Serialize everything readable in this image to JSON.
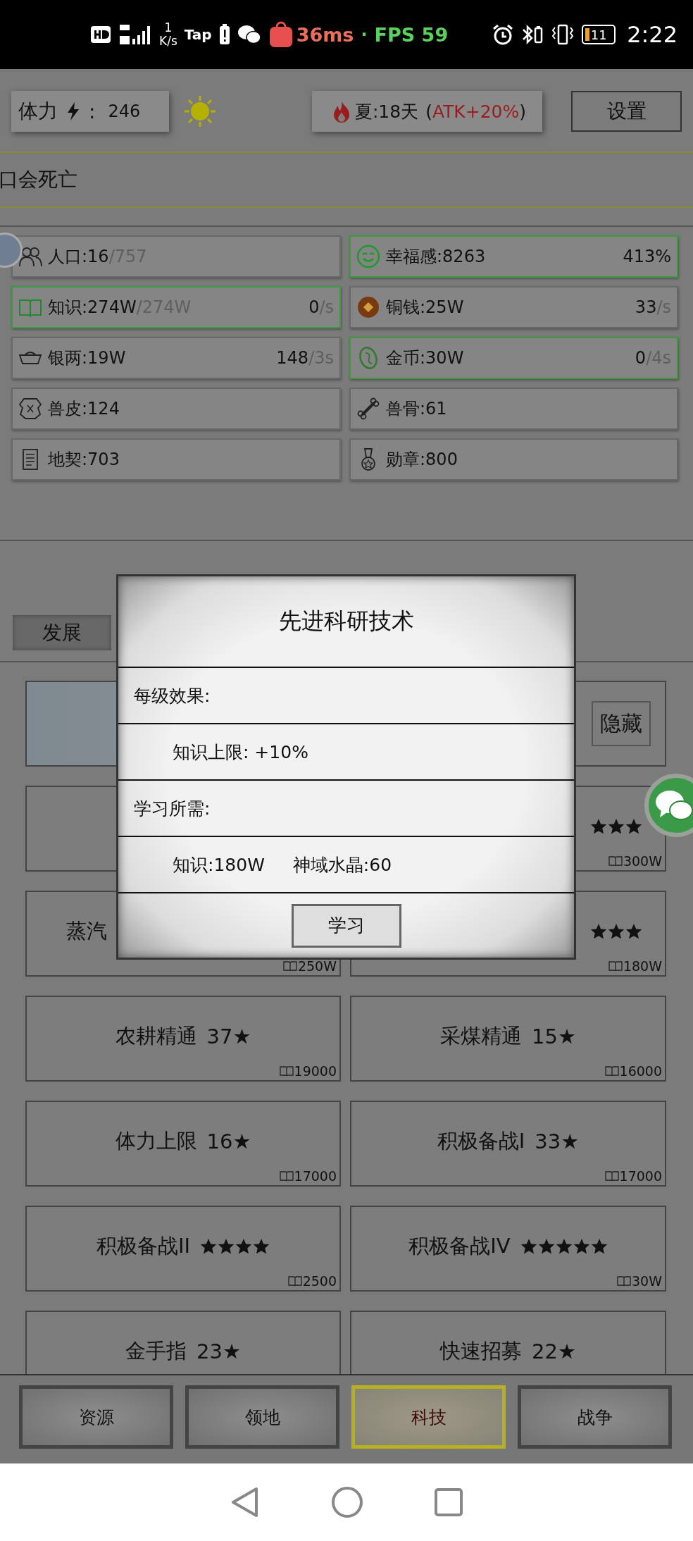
{
  "status_bar": {
    "speed_value": "1",
    "speed_unit": "K/s",
    "app_label": "Tap",
    "latency": "36ms",
    "dot": "·",
    "fps": "FPS 59",
    "battery": "11",
    "time": "2:22"
  },
  "top_bar": {
    "stamina_label": "体力",
    "stamina_colon": ":",
    "stamina_value": "246",
    "season": "夏:18天",
    "paren_open": "(",
    "season_bonus": "ATK+20%",
    "paren_close": ")",
    "settings": "设置"
  },
  "ticker": "口会死亡",
  "resources": [
    {
      "text": "人口:16",
      "limit": "/757",
      "highlighted": false
    },
    {
      "text": "幸福感:8263",
      "rate": "413%",
      "highlighted": true
    },
    {
      "text": "知识:274W",
      "limit": "/274W",
      "rate": "0",
      "period": "/s",
      "highlighted": true
    },
    {
      "text": "铜钱:25W",
      "rate": "33",
      "period": "/s",
      "highlighted": false
    },
    {
      "text": "银两:19W",
      "rate": "148",
      "period": "/3s",
      "highlighted": false
    },
    {
      "text": "金币:30W",
      "rate": "0",
      "period": "/4s",
      "highlighted": true
    },
    {
      "text": "兽皮:124",
      "highlighted": false
    },
    {
      "text": "兽骨:61",
      "highlighted": false
    },
    {
      "text": "地契:703",
      "highlighted": false
    },
    {
      "text": "勋章:800",
      "highlighted": false
    }
  ],
  "tabs": [
    {
      "label": "发展"
    }
  ],
  "techs": [
    {
      "kind": "blank"
    },
    {
      "kind": "toggle",
      "button": "隐藏"
    },
    {
      "kind": "empty"
    },
    {
      "kind": "right",
      "stars": 3,
      "cost": "300W"
    },
    {
      "kind": "left",
      "name": "蒸汽",
      "cost": "250W"
    },
    {
      "kind": "right",
      "stars": 3,
      "cost": "180W"
    },
    {
      "kind": "tech",
      "name": "农耕精通",
      "rating": "37★",
      "cost": "19000"
    },
    {
      "kind": "tech",
      "name": "采煤精通",
      "rating": "15★",
      "cost": "16000"
    },
    {
      "kind": "tech",
      "name": "体力上限",
      "rating": "16★",
      "cost": "17000"
    },
    {
      "kind": "tech",
      "name": "积极备战I",
      "rating": "33★",
      "cost": "17000"
    },
    {
      "kind": "tech",
      "name": "积极备战II",
      "stars": 4,
      "cost": "2500"
    },
    {
      "kind": "tech",
      "name": "积极备战IV",
      "stars": 5,
      "cost": "30W"
    },
    {
      "kind": "tech",
      "name": "金手指",
      "rating": "23★"
    },
    {
      "kind": "tech",
      "name": "快速招募",
      "rating": "22★"
    }
  ],
  "dialog": {
    "title": "先进科研技术",
    "sections": [
      {
        "kind": "heading",
        "text": "每级效果:"
      },
      {
        "kind": "detail",
        "items": [
          "知识上限:  +10%"
        ]
      },
      {
        "kind": "heading",
        "text": "学习所需:"
      },
      {
        "kind": "detail",
        "items": [
          "知识:180W",
          "神域水晶:60"
        ]
      }
    ],
    "button": "学习"
  },
  "bottom_nav": [
    {
      "label": "资源",
      "selected": false
    },
    {
      "label": "领地",
      "selected": false
    },
    {
      "label": "科技",
      "selected": true
    },
    {
      "label": "战争",
      "selected": false
    }
  ]
}
